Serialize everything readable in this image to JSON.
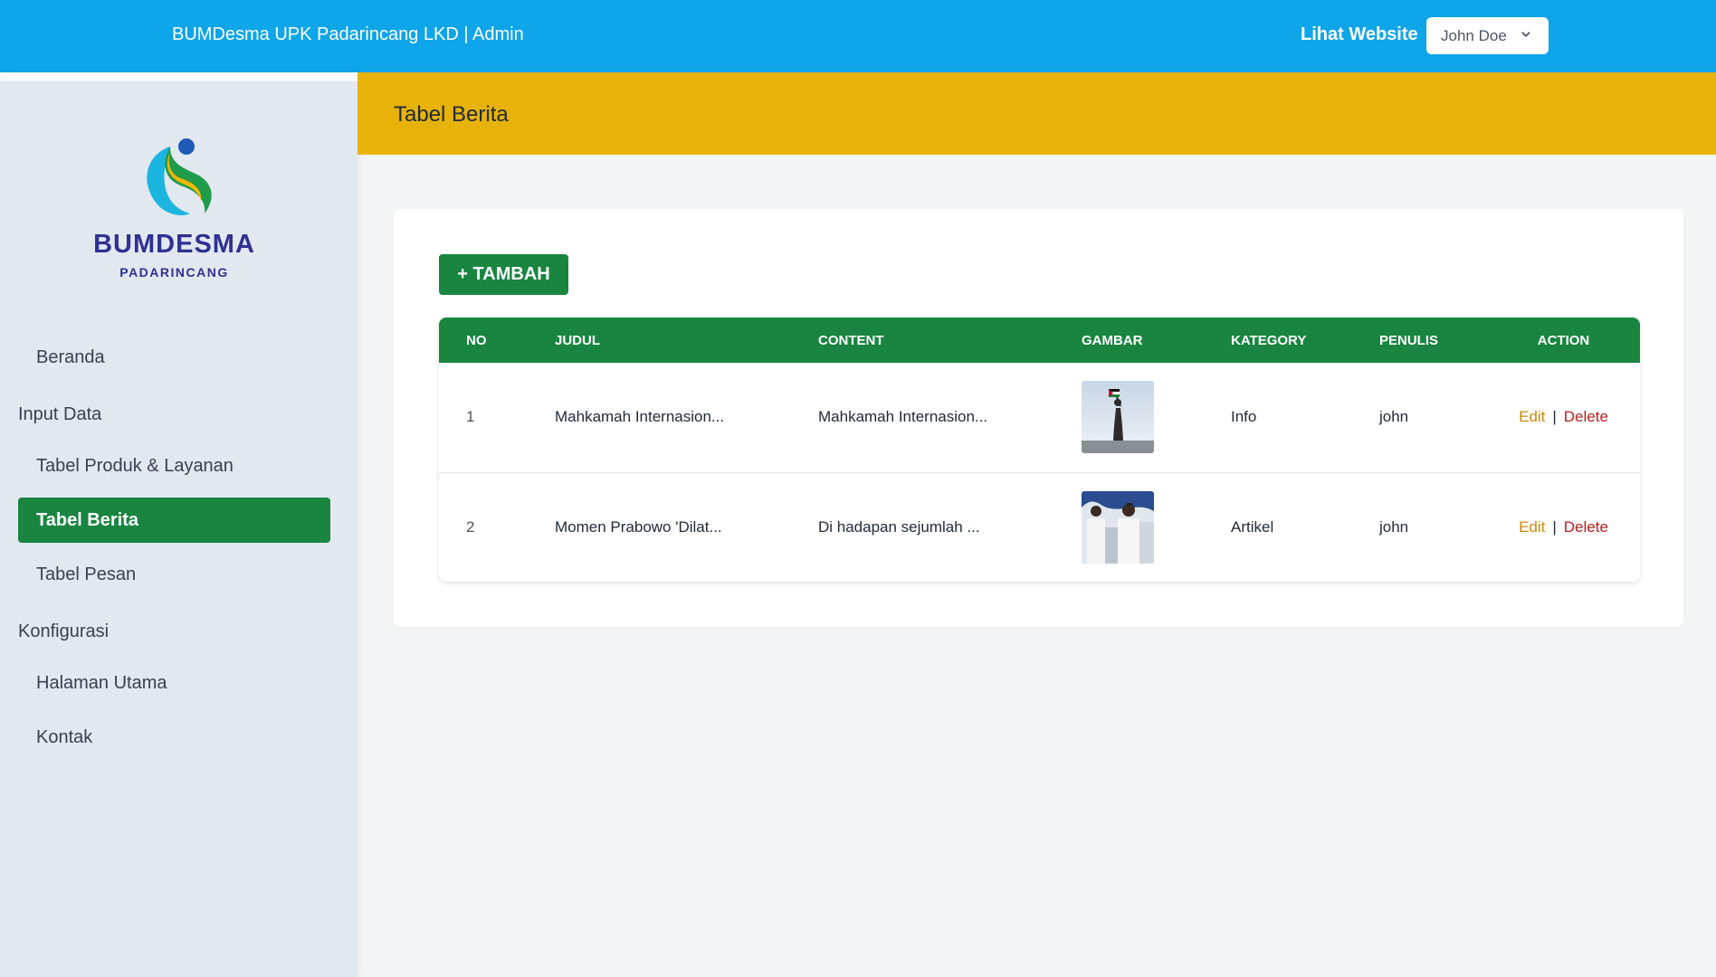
{
  "header": {
    "app_title": "BUMDesma UPK Padarincang LKD | Admin",
    "visit_website": "Lihat Website",
    "user_name": "John Doe"
  },
  "sidebar": {
    "logo_title": "BUMDESMA",
    "logo_subtitle": "PADARINCANG",
    "items": [
      {
        "label": "Beranda"
      },
      {
        "label": "Input Data"
      },
      {
        "label": "Tabel Produk & Layanan"
      },
      {
        "label": "Tabel Berita"
      },
      {
        "label": "Tabel Pesan"
      },
      {
        "label": "Konfigurasi"
      },
      {
        "label": "Halaman Utama"
      },
      {
        "label": "Kontak"
      }
    ],
    "active": "Tabel Berita"
  },
  "page": {
    "title": "Tabel Berita",
    "add_button": "+ TAMBAH"
  },
  "table": {
    "columns": [
      "NO",
      "JUDUL",
      "CONTENT",
      "GAMBAR",
      "KATEGORY",
      "PENULIS",
      "ACTION"
    ],
    "rows": [
      {
        "no": "1",
        "judul": "Mahkamah Internasion...",
        "content": "Mahkamah Internasion...",
        "kategory": "Info",
        "penulis": "john",
        "edit": "Edit",
        "separator": "|",
        "delete": "Delete"
      },
      {
        "no": "2",
        "judul": "Momen Prabowo 'Dilat...",
        "content": "Di hadapan sejumlah ...",
        "kategory": "Artikel",
        "penulis": "john",
        "edit": "Edit",
        "separator": "|",
        "delete": "Delete"
      }
    ]
  },
  "colors": {
    "topbar": "#0ea5e9",
    "header_band": "#e8b308",
    "primary_green": "#198541",
    "edit": "#ca8a04",
    "delete": "#b91c1c"
  }
}
